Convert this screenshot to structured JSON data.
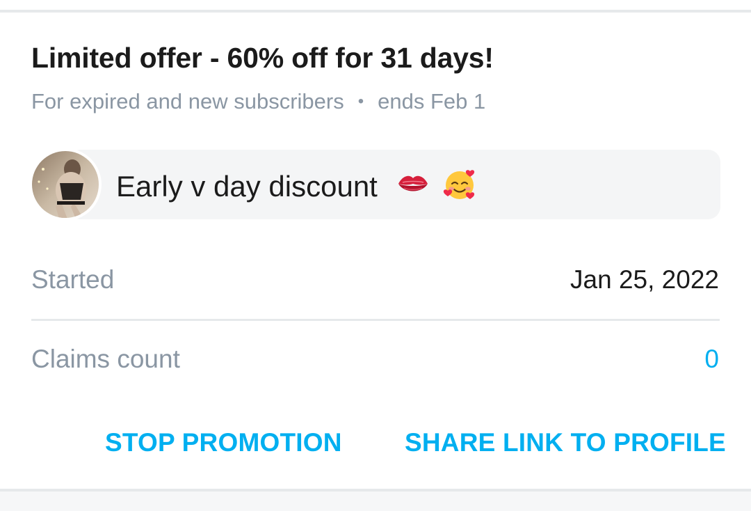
{
  "promotion": {
    "title": "Limited offer - 60% off for 31 days!",
    "audience": "For expired and new subscribers",
    "separator": "•",
    "ends": "ends Feb 1",
    "message": "Early v day discount",
    "message_emojis": [
      "kiss-mark-icon",
      "smiling-face-with-hearts-icon"
    ]
  },
  "details": {
    "started_label": "Started",
    "started_value": "Jan 25, 2022",
    "claims_label": "Claims count",
    "claims_value": "0"
  },
  "actions": {
    "stop_label": "STOP PROMOTION",
    "share_label": "SHARE LINK TO PROFILE"
  },
  "colors": {
    "accent": "#00aff0",
    "muted_text": "#8a96a3",
    "primary_text": "#1b1b1b",
    "bubble_bg": "#f4f5f6",
    "divider": "#e6e9eb"
  }
}
